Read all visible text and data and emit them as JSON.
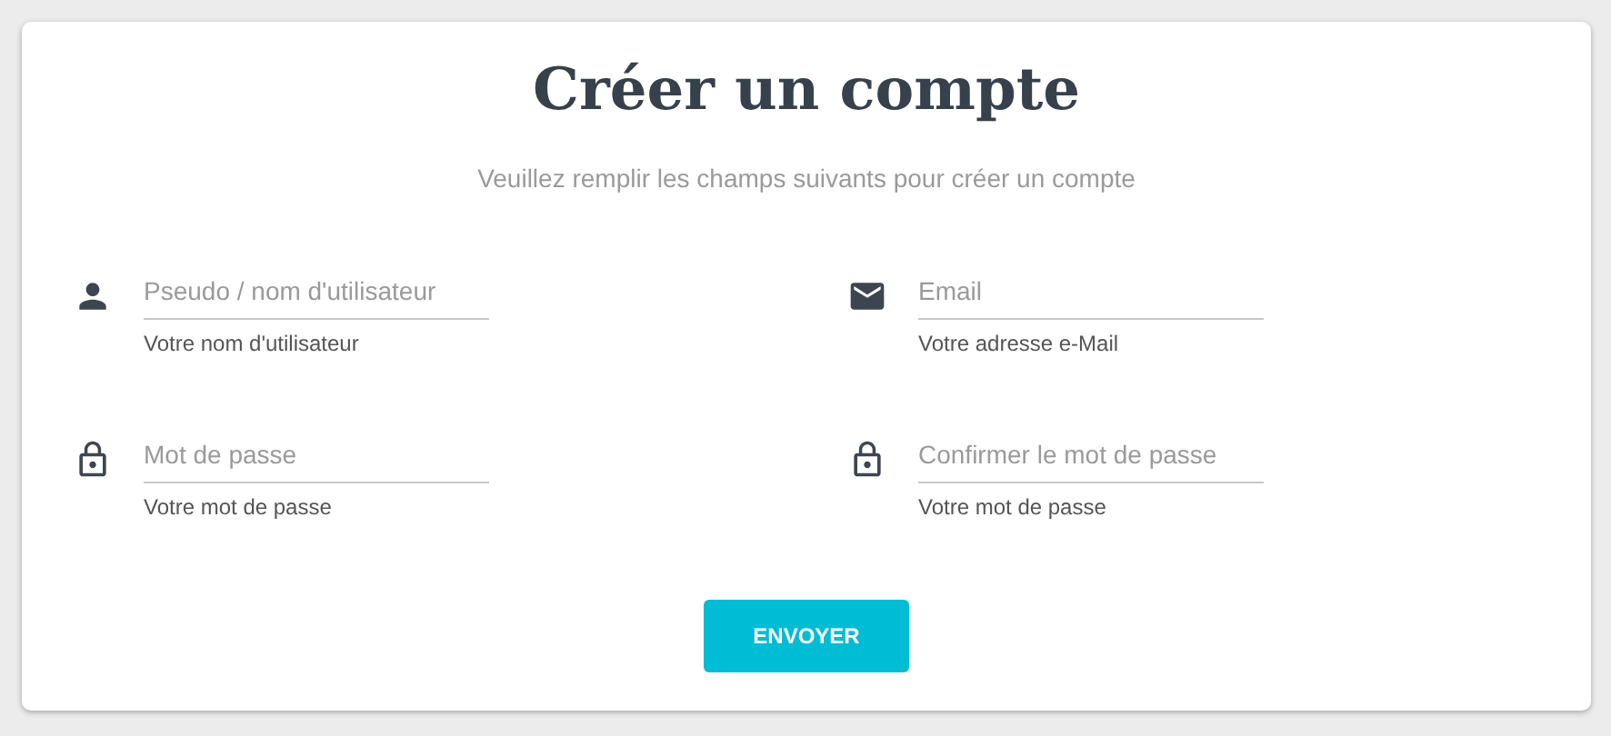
{
  "title": "Créer un compte",
  "subtitle": "Veuillez remplir les champs suivants pour créer un compte",
  "fields": [
    {
      "kind": "username",
      "placeholder": "Pseudo / nom d'utilisateur",
      "helper": "Votre nom d'utilisateur"
    },
    {
      "kind": "email",
      "placeholder": "Email",
      "helper": "Votre adresse e-Mail"
    },
    {
      "kind": "password",
      "placeholder": "Mot de passe",
      "helper": "Votre mot de passe"
    },
    {
      "kind": "password",
      "placeholder": "Confirmer le mot de passe",
      "helper": "Votre mot de passe"
    }
  ],
  "submit": {
    "label": "ENVOYER"
  }
}
